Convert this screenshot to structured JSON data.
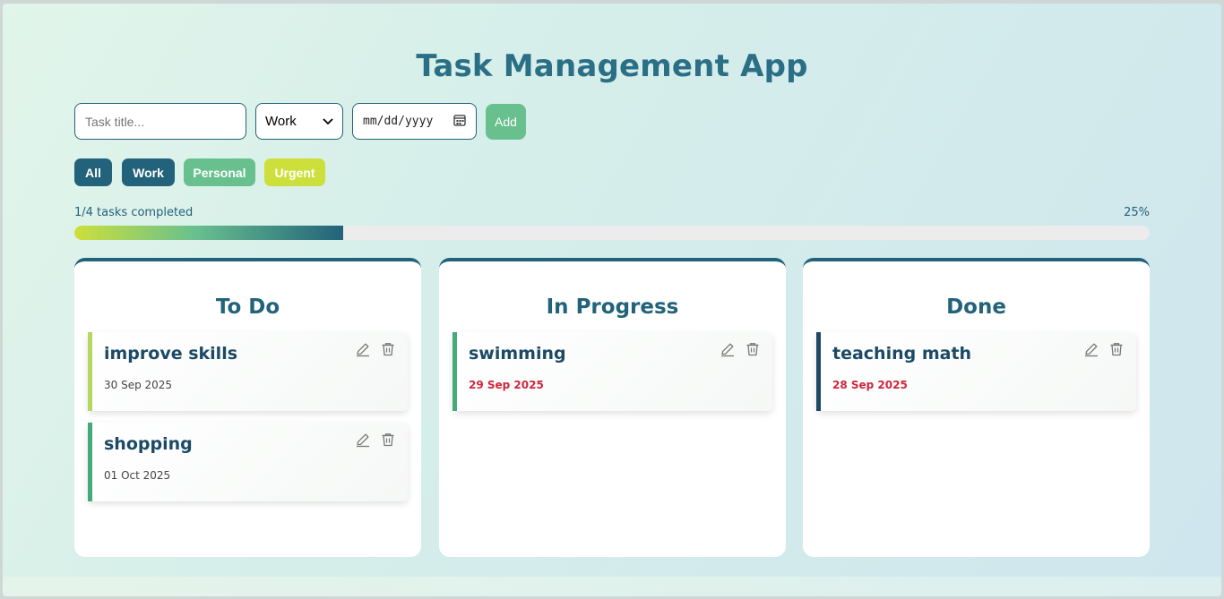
{
  "header": {
    "title": "Task Management App"
  },
  "form": {
    "title_placeholder": "Task title...",
    "category_selected": "Work",
    "date_placeholder": "mm/dd/yyyy",
    "add_label": "Add"
  },
  "filters": [
    {
      "label": "All",
      "color": "#22627a"
    },
    {
      "label": "Work",
      "color": "#22627a"
    },
    {
      "label": "Personal",
      "color": "#68c08f"
    },
    {
      "label": "Urgent",
      "color": "#cddf3a"
    }
  ],
  "progress": {
    "label": "1/4 tasks completed",
    "percent_label": "25%",
    "fraction": 0.25
  },
  "columns": [
    {
      "title": "To Do",
      "tasks": [
        {
          "title": "improve skills",
          "date": "30 Sep 2025",
          "overdue": false,
          "bar_color": "#b4d860"
        },
        {
          "title": "shopping",
          "date": "01 Oct 2025",
          "overdue": false,
          "bar_color": "#45aa7a"
        }
      ]
    },
    {
      "title": "In Progress",
      "tasks": [
        {
          "title": "swimming",
          "date": "29 Sep 2025",
          "overdue": true,
          "bar_color": "#45aa7a"
        }
      ]
    },
    {
      "title": "Done",
      "tasks": [
        {
          "title": "teaching math",
          "date": "28 Sep 2025",
          "overdue": true,
          "bar_color": "#1c4966"
        }
      ]
    }
  ],
  "icons": {
    "edit": "pencil-icon",
    "delete": "trash-icon",
    "calendar": "calendar-icon",
    "dropdown": "chevron-down-icon"
  }
}
